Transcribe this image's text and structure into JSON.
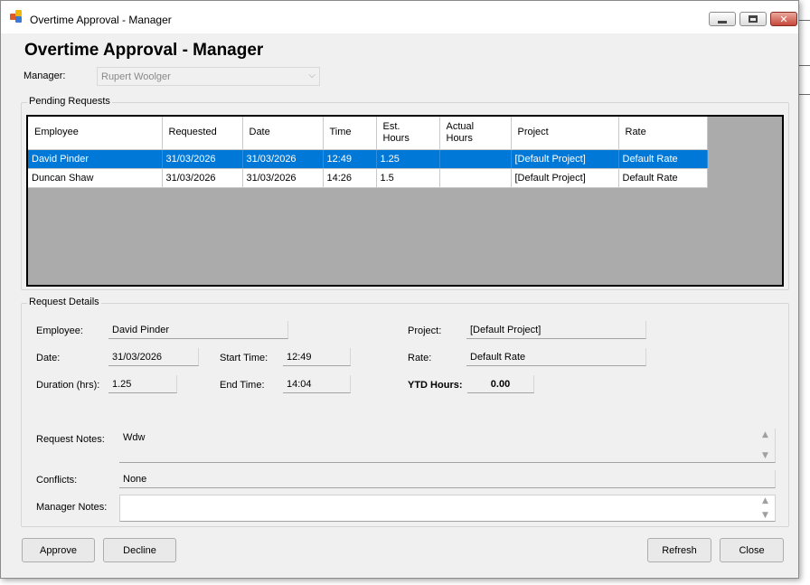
{
  "window": {
    "title": "Overtime Approval - Manager",
    "heading": "Overtime Approval - Manager"
  },
  "manager": {
    "label": "Manager:",
    "value": "Rupert Woolger"
  },
  "pending": {
    "title": "Pending Requests",
    "columns": [
      {
        "line1": "Employee",
        "line2": ""
      },
      {
        "line1": "Requested",
        "line2": ""
      },
      {
        "line1": "Date",
        "line2": ""
      },
      {
        "line1": "Time",
        "line2": ""
      },
      {
        "line1": "Est.",
        "line2": "Hours"
      },
      {
        "line1": "Actual",
        "line2": "Hours"
      },
      {
        "line1": "Project",
        "line2": ""
      },
      {
        "line1": "Rate",
        "line2": ""
      }
    ],
    "rows": [
      {
        "employee": "David Pinder",
        "requested": "31/03/2026",
        "date": "31/03/2026",
        "time": "12:49",
        "est_hours": "1.25",
        "actual_hours": "",
        "project": "[Default Project]",
        "rate": "Default Rate",
        "selected": true
      },
      {
        "employee": "Duncan Shaw",
        "requested": "31/03/2026",
        "date": "31/03/2026",
        "time": "14:26",
        "est_hours": "1.5",
        "actual_hours": "",
        "project": "[Default Project]",
        "rate": "Default Rate",
        "selected": false
      }
    ]
  },
  "details": {
    "title": "Request Details",
    "employee_label": "Employee:",
    "employee_value": "David Pinder",
    "date_label": "Date:",
    "date_value": "31/03/2026",
    "start_label": "Start Time:",
    "start_value": "12:49",
    "duration_label": "Duration (hrs):",
    "duration_value": "1.25",
    "end_label": "End Time:",
    "end_value": "14:04",
    "project_label": "Project:",
    "project_value": "[Default Project]",
    "rate_label": "Rate:",
    "rate_value": "Default Rate",
    "ytd_label": "YTD Hours:",
    "ytd_value": "0.00",
    "request_notes_label": "Request Notes:",
    "request_notes_value": "Wdw",
    "conflicts_label": "Conflicts:",
    "conflicts_value": "None",
    "manager_notes_label": "Manager Notes:",
    "manager_notes_value": ""
  },
  "buttons": {
    "approve": "Approve",
    "decline": "Decline",
    "refresh": "Refresh",
    "close": "Close"
  },
  "colors": {
    "selection": "#0078d7",
    "grid_background": "#ababab",
    "window_background": "#f0f0f0",
    "close_button": "#c7463a"
  },
  "icons": {
    "app": "app-icon",
    "minimize": "minimize-icon",
    "maximize": "maximize-icon",
    "close": "close-icon",
    "dropdown": "chevron-down-icon",
    "scroll_up": "scroll-up-arrow-icon",
    "scroll_down": "scroll-down-arrow-icon"
  }
}
